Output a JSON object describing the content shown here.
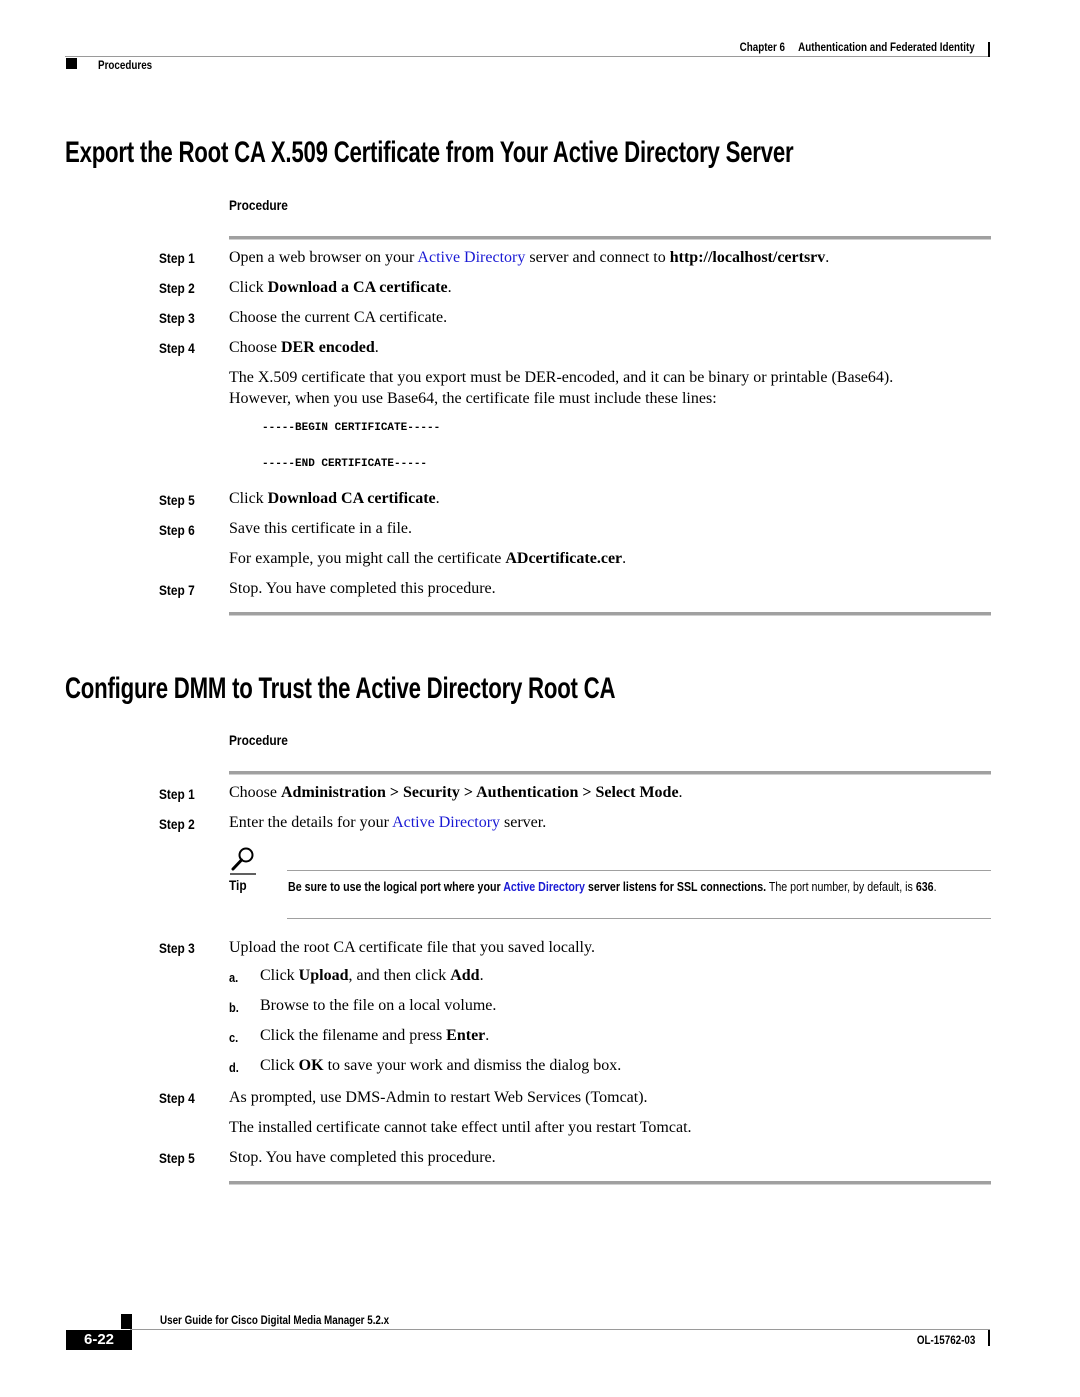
{
  "header": {
    "chapter": "Chapter 6",
    "chapter_title": "Authentication and Federated Identity",
    "section": "Procedures"
  },
  "section1": {
    "title": "Export the Root CA X.509 Certificate from Your Active Directory Server",
    "procedure_label": "Procedure",
    "steps": [
      {
        "label": "Step 1",
        "pre": "Open a web browser on your ",
        "link": "Active Directory",
        "mid": " server and connect to ",
        "bold": "http://localhost/certsrv",
        "post": "."
      },
      {
        "label": "Step 2",
        "pre": "Click ",
        "bold": "Download a CA certificate",
        "post": "."
      },
      {
        "label": "Step 3",
        "text": "Choose the current CA certificate."
      },
      {
        "label": "Step 4",
        "pre": "Choose ",
        "bold": "DER encoded",
        "post": "."
      },
      {
        "label": "Step 5",
        "pre": "Click ",
        "bold": "Download CA certificate",
        "post": "."
      },
      {
        "label": "Step 6",
        "text": "Save this certificate in a file."
      },
      {
        "label": "Step 7",
        "text": "Stop. You have completed this procedure."
      }
    ],
    "step4_note_line1": "The X.509 certificate that you export must be DER-encoded, and it can be binary or printable (Base64).",
    "step4_note_line2": "However, when you use Base64, the certificate file must include these lines:",
    "code_begin": "-----BEGIN CERTIFICATE-----",
    "code_end": "-----END CERTIFICATE-----",
    "step6_note_pre": "For example, you might call the certificate ",
    "step6_note_bold": "ADcertificate.cer",
    "step6_note_post": "."
  },
  "section2": {
    "title": "Configure DMM to Trust the Active Directory Root CA",
    "procedure_label": "Procedure",
    "steps": [
      {
        "label": "Step 1",
        "pre": "Choose ",
        "bold": "Administration > Security > Authentication > Select Mode",
        "post": "."
      },
      {
        "label": "Step 2",
        "pre": "Enter the details for your ",
        "link": "Active Directory",
        "post": " server."
      },
      {
        "label": "Step 3",
        "text": "Upload the root CA certificate file that you saved locally."
      },
      {
        "label": "Step 4",
        "text": "As prompted, use DMS-Admin to restart Web Services (Tomcat)."
      },
      {
        "label": "Step 5",
        "text": "Stop. You have completed this procedure."
      }
    ],
    "tip": {
      "label": "Tip",
      "bold_pre": "Be sure to use the logical port where your ",
      "link": "Active Directory",
      "bold_post": " server listens for SSL connections.",
      "text1": " The port number, by default, is ",
      "port": "636",
      "text2": "."
    },
    "substeps": [
      {
        "letter": "a.",
        "pre": "Click ",
        "b1": "Upload",
        "mid": ", and then click ",
        "b2": "Add",
        "post": "."
      },
      {
        "letter": "b.",
        "text": "Browse to the file on a local volume."
      },
      {
        "letter": "c.",
        "pre": "Click the filename and press ",
        "b1": "Enter",
        "post": "."
      },
      {
        "letter": "d.",
        "pre": "Click ",
        "b1": "OK",
        "post": " to save your work and dismiss the dialog box."
      }
    ],
    "step4_note": "The installed certificate cannot take effect until after you restart Tomcat."
  },
  "footer": {
    "guide_title": "User Guide for Cisco Digital Media Manager 5.2.x",
    "page_number": "6-22",
    "doc_number": "OL-15762-03"
  }
}
